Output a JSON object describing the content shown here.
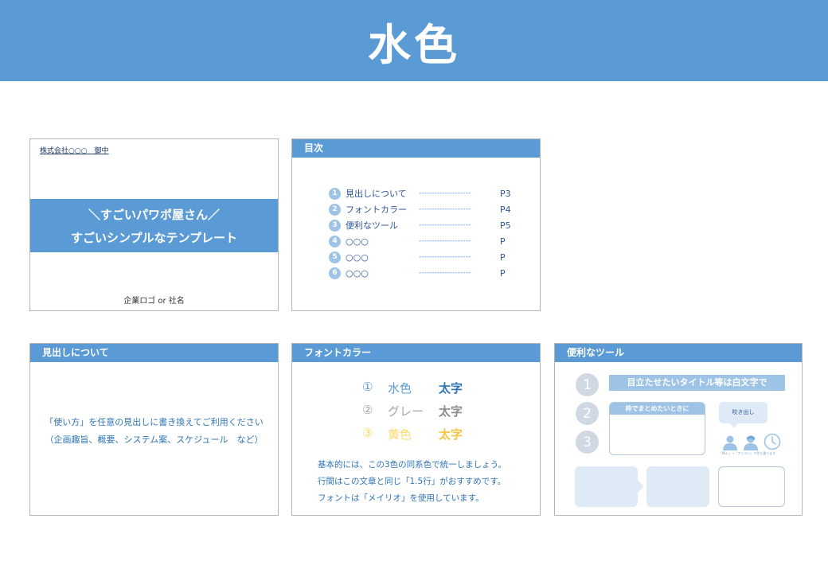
{
  "banner": {
    "title": "水色"
  },
  "colors": {
    "accent": "#5b9bd5",
    "light": "#9dc3e6",
    "pale": "#deebf7",
    "gray": "#a6a6a6",
    "yellow": "#ffd966"
  },
  "slide_cover": {
    "client": "株式会社○○○　御中",
    "title_line1": "＼すごいパワポ屋さん／",
    "title_line2": "すごいシンプルなテンプレート",
    "logo": "企業ロゴ or 社名"
  },
  "slide_toc": {
    "header": "目次",
    "items": [
      {
        "num": "1",
        "label": "見出しについて",
        "dashes": "--------------------",
        "page": "P3"
      },
      {
        "num": "2",
        "label": "フォントカラー",
        "dashes": "--------------------",
        "page": "P4"
      },
      {
        "num": "3",
        "label": "便利なツール",
        "dashes": "--------------------",
        "page": "P5"
      },
      {
        "num": "4",
        "label": "○○○",
        "dashes": "--------------------",
        "page": "P"
      },
      {
        "num": "5",
        "label": "○○○",
        "dashes": "--------------------",
        "page": "P"
      },
      {
        "num": "6",
        "label": "○○○",
        "dashes": "--------------------",
        "page": "P"
      }
    ]
  },
  "slide_heading": {
    "header": "見出しについて",
    "line1": "「使い方」を任意の見出しに書き換えてご利用ください",
    "line2": "（企画趣旨、概要、システム案、スケジュール　など）"
  },
  "slide_fontcolor": {
    "header": "フォントカラー",
    "rows": [
      {
        "num": "①",
        "name": "水色",
        "bold": "太字"
      },
      {
        "num": "②",
        "name": "グレー",
        "bold": "太字"
      },
      {
        "num": "③",
        "name": "黄色",
        "bold": "太字"
      }
    ],
    "note1": "基本的には、この3色の同系色で統一しましょう。",
    "note2": "行間はこの文章と同じ「1.5行」がおすすめです。",
    "note3": "フォントは「メイリオ」を使用しています。"
  },
  "slide_tools": {
    "header": "便利なツール",
    "circles": [
      "1",
      "2",
      "3"
    ],
    "title_box": "目立たせたいタイトル等は白文字で",
    "frame_title": "枠でまとめたいときに",
    "bubble": "吹き出し",
    "icon_caption": "「挿入」→「アイコン」で色々選べます",
    "icons": [
      "person-icon",
      "person-icon",
      "clock-icon"
    ]
  }
}
